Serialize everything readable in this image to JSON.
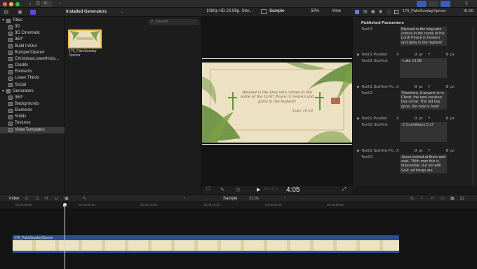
{
  "toolbar": {
    "key_label": "O−",
    "colors": {
      "bg": "#2b2b2b",
      "accent": "#3b5db8",
      "close": "#ff5f57",
      "min": "#febc2e",
      "max": "#28c840"
    }
  },
  "libraries": {
    "items": [
      {
        "label": "Titles",
        "level": 0,
        "expanded": true
      },
      {
        "label": "3D",
        "level": 1
      },
      {
        "label": "3D Cinematic",
        "level": 1
      },
      {
        "label": "360°",
        "level": 1
      },
      {
        "label": "Build In/Out",
        "level": 1
      },
      {
        "label": "Bumper/Opener",
        "level": 1
      },
      {
        "label": "ChristmasLowerthirds...",
        "level": 1
      },
      {
        "label": "Credits",
        "level": 1
      },
      {
        "label": "Elements",
        "level": 1
      },
      {
        "label": "Lower Thirds",
        "level": 1
      },
      {
        "label": "Social",
        "level": 1
      },
      {
        "label": "Generators",
        "level": 0,
        "expanded": true
      },
      {
        "label": "360°",
        "level": 1
      },
      {
        "label": "Backgrounds",
        "level": 1
      },
      {
        "label": "Elements",
        "level": 1
      },
      {
        "label": "Solids",
        "level": 1
      },
      {
        "label": "Textures",
        "level": 1
      },
      {
        "label": "VideoTemplates",
        "level": 1,
        "selected": true
      }
    ]
  },
  "browser": {
    "title": "Installed Generators",
    "search_placeholder": "Search",
    "clip_name": "179_PalmSunday Opener"
  },
  "viewer": {
    "format": "1080p HD 23.98p, Ster...",
    "clip": "Sample",
    "zoom": "50%",
    "view_label": "View",
    "timecode": "4:05",
    "frame": {
      "text": "Blessed is the king who comes in the name of the Lord! Peace in heaven and glory in the highest!",
      "citation": "- Luke 19:38"
    }
  },
  "inspector": {
    "clip_name": "179_PalmSundayOpener",
    "duration": "31:06",
    "section": "Published Parameters",
    "rows": [
      {
        "kind": "text",
        "label": "Text01",
        "value": "Blessed is the king who comes in the name of the Lord! Peace in heaven and glory in the highest!"
      },
      {
        "kind": "pos",
        "label": "Text01 Position",
        "x_label": "X",
        "x": "0",
        "y_label": "Y",
        "y": "0",
        "unit": "px"
      },
      {
        "kind": "text",
        "label": "Text01 SubText",
        "value": "-Luke 19:38"
      },
      {
        "kind": "pos",
        "label": "Text01 SubText Po...",
        "x_label": "X",
        "x": "0",
        "y_label": "Y",
        "y": "0",
        "unit": "px"
      },
      {
        "kind": "text",
        "label": "Text02",
        "value": "Therefore, if anyone is in Christ, the new creation has come: The old has gone, the new is here!"
      },
      {
        "kind": "pos",
        "label": "Text02 Position",
        "x_label": "X",
        "x": "0",
        "y_label": "Y",
        "y": "0",
        "unit": "px"
      },
      {
        "kind": "text",
        "label": "Text02 SubText",
        "value": "-2 Corinthians 5:17"
      },
      {
        "kind": "pos",
        "label": "Text02 SubText Po...",
        "x_label": "X",
        "x": "0",
        "y_label": "Y",
        "y": "0",
        "unit": "px"
      },
      {
        "kind": "text",
        "label": "Text03",
        "value": "Jesus looked at them and said, \"With man this is impossible, but not with God; all things are possible"
      }
    ]
  },
  "timeline": {
    "index_label": "Index",
    "project": "Sample",
    "duration": "31:06",
    "ticks": [
      "00:00:00:00",
      "00:00:05:00",
      "00:00:10:00",
      "00:00:15:00",
      "00:00:20:00",
      "00:00:25:00"
    ],
    "clip_name": "179_PalmSundayOpener"
  }
}
